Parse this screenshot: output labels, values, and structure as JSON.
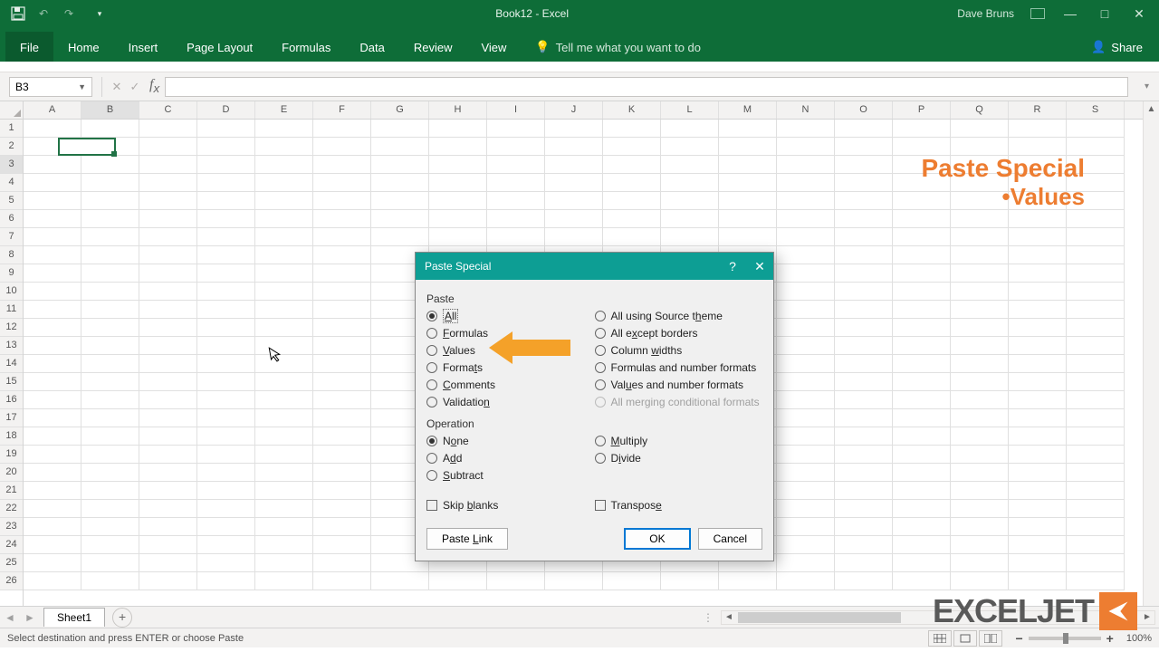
{
  "title_bar": {
    "doc_title": "Book12 - Excel",
    "user_name": "Dave Bruns"
  },
  "ribbon": {
    "tabs": [
      "File",
      "Home",
      "Insert",
      "Page Layout",
      "Formulas",
      "Data",
      "Review",
      "View"
    ],
    "tell_me": "Tell me what you want to do",
    "share": "Share"
  },
  "name_box": "B3",
  "columns": [
    "A",
    "B",
    "C",
    "D",
    "E",
    "F",
    "G",
    "H",
    "I",
    "J",
    "K",
    "L",
    "M",
    "N",
    "O",
    "P",
    "Q",
    "R",
    "S"
  ],
  "rows": [
    "1",
    "2",
    "3",
    "4",
    "5",
    "6",
    "7",
    "8",
    "9",
    "10",
    "11",
    "12",
    "13",
    "14",
    "15",
    "16",
    "17",
    "18",
    "19",
    "20",
    "21",
    "22",
    "23",
    "24",
    "25",
    "26"
  ],
  "active_cell": {
    "col_index": 1,
    "row_index": 2
  },
  "overlay": {
    "line1": "Paste Special",
    "line2": "•Values"
  },
  "dialog": {
    "title": "Paste Special",
    "section_paste": "Paste",
    "section_operation": "Operation",
    "paste_left": [
      {
        "label": "All",
        "u": "A",
        "checked": true
      },
      {
        "label": "Formulas",
        "u": "F"
      },
      {
        "label": "Values",
        "u": "V"
      },
      {
        "label": "Formats",
        "u": "t"
      },
      {
        "label": "Comments",
        "u": "C"
      },
      {
        "label": "Validation",
        "u": "n"
      }
    ],
    "paste_right": [
      {
        "label": "All using Source theme",
        "u": "h"
      },
      {
        "label": "All except borders",
        "u": "x"
      },
      {
        "label": "Column widths",
        "u": "w"
      },
      {
        "label": "Formulas and number formats",
        "u": "R"
      },
      {
        "label": "Values and number formats",
        "u": "u"
      },
      {
        "label": "All merging conditional formats",
        "disabled": true
      }
    ],
    "op_left": [
      {
        "label": "None",
        "u": "o",
        "checked": true
      },
      {
        "label": "Add",
        "u": "d"
      },
      {
        "label": "Subtract",
        "u": "S"
      }
    ],
    "op_right": [
      {
        "label": "Multiply",
        "u": "M"
      },
      {
        "label": "Divide",
        "u": "i"
      }
    ],
    "skip_blanks": "Skip blanks",
    "transpose": "Transpose",
    "paste_link": "Paste Link",
    "ok": "OK",
    "cancel": "Cancel"
  },
  "sheet_tab": "Sheet1",
  "status_text": "Select destination and press ENTER or choose Paste",
  "zoom": "100%",
  "logo": {
    "text1": "EXCEL",
    "text2": "JET"
  }
}
